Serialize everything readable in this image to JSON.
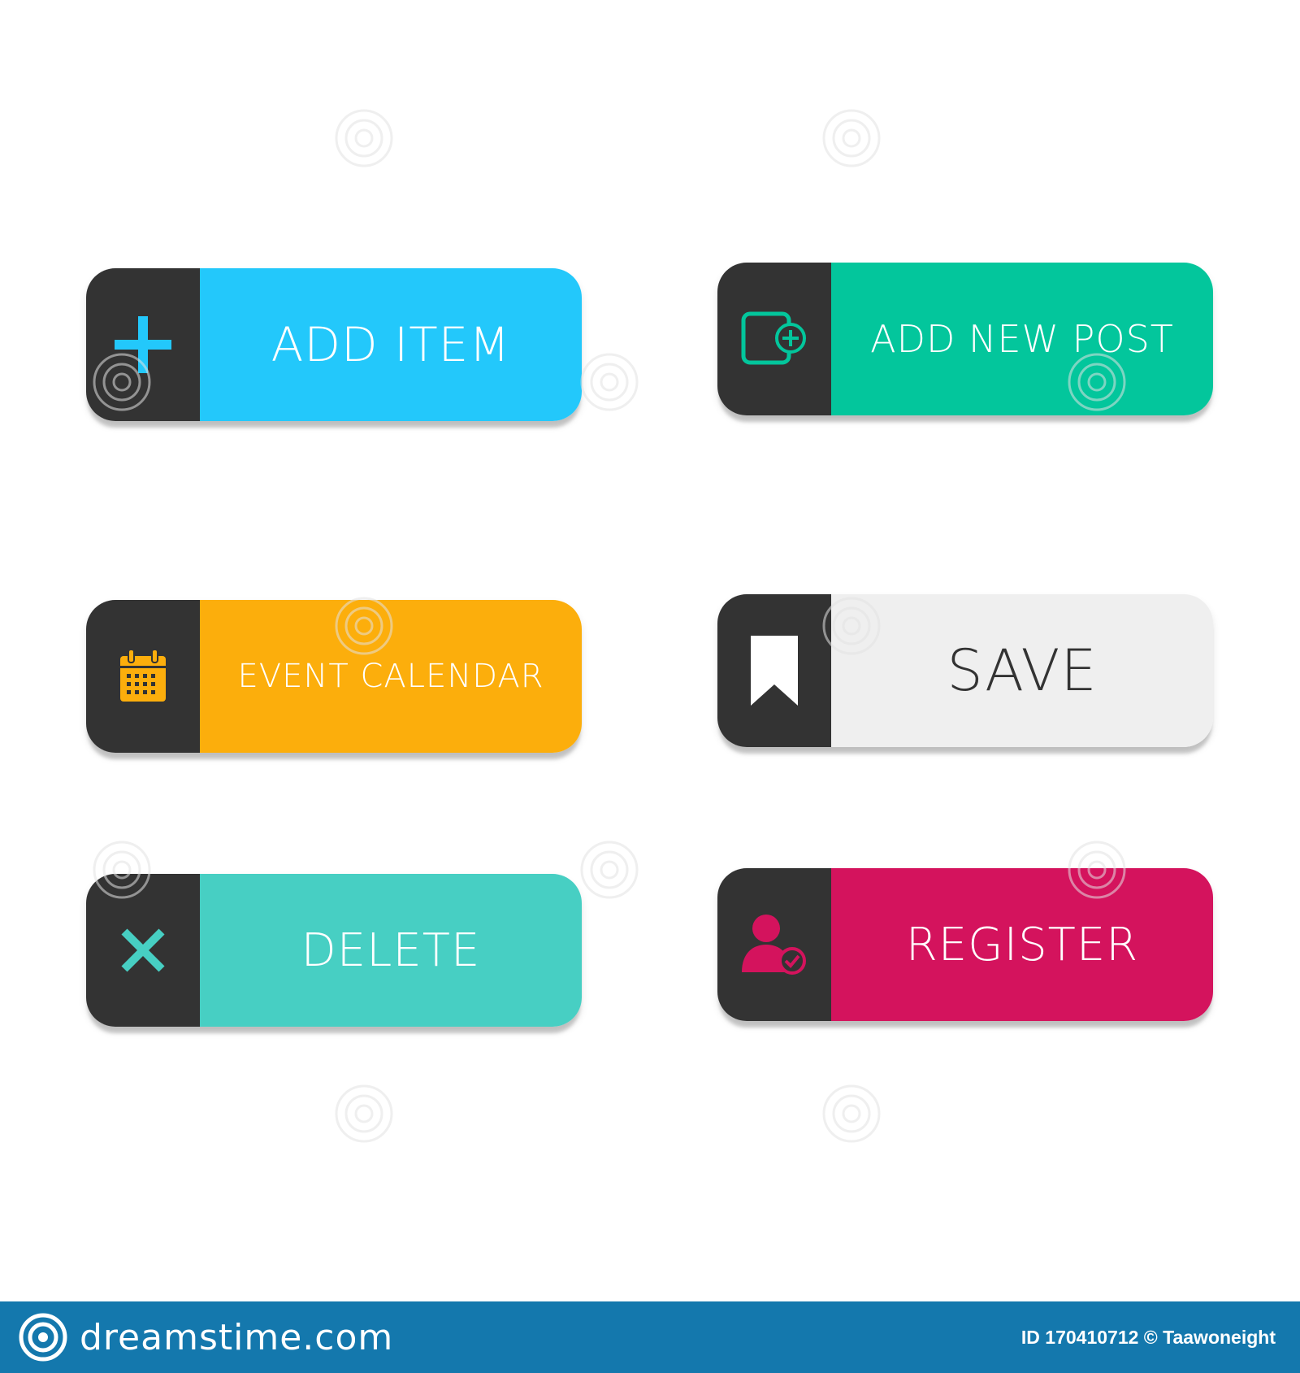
{
  "buttons": [
    {
      "label": "ADD ITEM",
      "icon": "plus-icon",
      "color": "#23c8fb",
      "text_color": "#ffffff",
      "icon_color": "#23c8fb"
    },
    {
      "label": "ADD NEW POST",
      "icon": "new-post-icon",
      "color": "#03c69c",
      "text_color": "#ffffff",
      "icon_color": "#03c69c"
    },
    {
      "label": "EVENT CALENDAR",
      "icon": "calendar-icon",
      "color": "#fcae0c",
      "text_color": "#ffffff",
      "icon_color": "#fcae0c"
    },
    {
      "label": "SAVE",
      "icon": "bookmark-icon",
      "color": "#efefef",
      "text_color": "#333333",
      "icon_color": "#ffffff"
    },
    {
      "label": "DELETE",
      "icon": "close-icon",
      "color": "#47cfc3",
      "text_color": "#ffffff",
      "icon_color": "#47cfc3"
    },
    {
      "label": "REGISTER",
      "icon": "user-check-icon",
      "color": "#d4135d",
      "text_color": "#ffffff",
      "icon_color": "#d4135d"
    }
  ],
  "footer": {
    "brand": "dreamstime.com",
    "credit": "ID 170410712 © Taawoneight",
    "background": "#1478ad"
  },
  "watermark": {
    "text": "dreamstime"
  }
}
